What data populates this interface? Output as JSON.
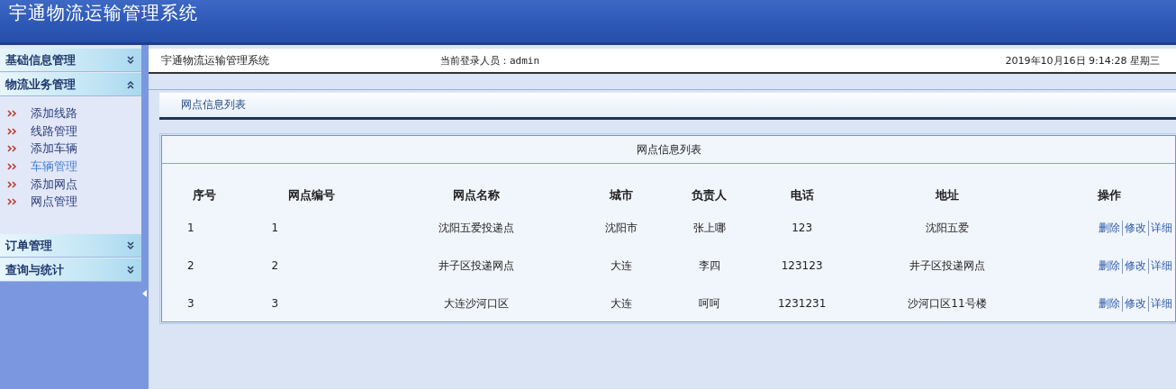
{
  "header": {
    "title": "宇通物流运输管理系统"
  },
  "sidebar": {
    "sections": [
      {
        "label": "基础信息管理",
        "expanded": false
      },
      {
        "label": "物流业务管理",
        "expanded": true,
        "items": [
          {
            "label": "添加线路",
            "selected": false
          },
          {
            "label": "线路管理",
            "selected": false
          },
          {
            "label": "添加车辆",
            "selected": false
          },
          {
            "label": "车辆管理",
            "selected": true
          },
          {
            "label": "添加网点",
            "selected": false
          },
          {
            "label": "网点管理",
            "selected": false
          }
        ]
      },
      {
        "label": "订单管理",
        "expanded": false
      },
      {
        "label": "查询与统计",
        "expanded": false
      }
    ]
  },
  "top_bar": {
    "system_name": "宇通物流运输管理系统",
    "login_user": "当前登录人员：admin",
    "datetime": "2019年10月16日  9:14:28 星期三"
  },
  "tab": {
    "label": "网点信息列表"
  },
  "table": {
    "caption": "网点信息列表",
    "columns": [
      "序号",
      "网点编号",
      "网点名称",
      "城市",
      "负责人",
      "电话",
      "地址",
      "操作"
    ],
    "rows": [
      {
        "cells": [
          "1",
          "1",
          "沈阳五爱投递点",
          "沈阳市",
          "张上哪",
          "123",
          "沈阳五爱"
        ],
        "actions": [
          "删除",
          "修改",
          "详细"
        ]
      },
      {
        "cells": [
          "2",
          "2",
          "井子区投递网点",
          "大连",
          "李四",
          "123123",
          "井子区投递网点"
        ],
        "actions": [
          "删除",
          "修改",
          "详细"
        ]
      },
      {
        "cells": [
          "3",
          "3",
          "大连沙河口区",
          "大连",
          "呵呵",
          "1231231",
          "沙河口区11号楼"
        ],
        "actions": [
          "删除",
          "修改",
          "详细"
        ]
      }
    ]
  }
}
